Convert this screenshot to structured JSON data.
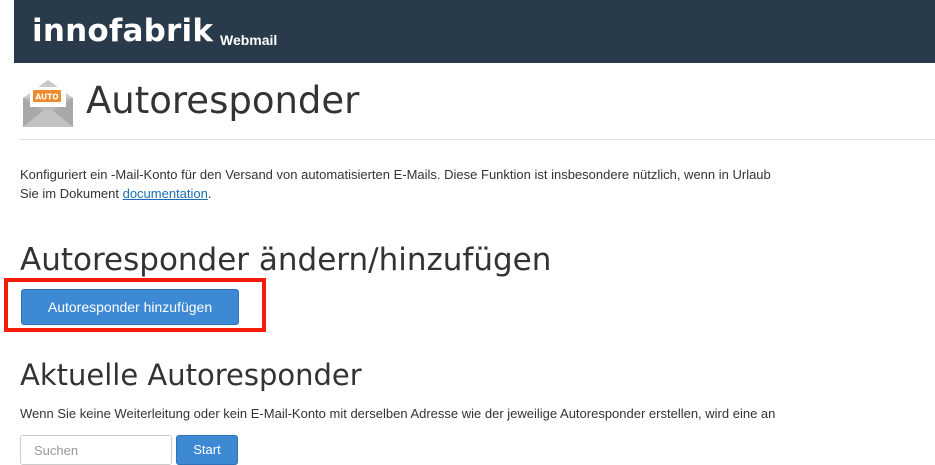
{
  "header": {
    "brand": "innofabrik",
    "subtitle": "Webmail"
  },
  "page": {
    "icon": "autoresponder-envelope-icon",
    "icon_badge": "AUTO",
    "title": "Autoresponder"
  },
  "description": {
    "line1": "Konfiguriert ein -Mail-Konto für den Versand von automatisierten E-Mails. Diese Funktion ist insbesondere nützlich, wenn in Urlaub",
    "line2_prefix": "Sie im Dokument ",
    "link_label": "documentation",
    "line2_suffix": "."
  },
  "section_add": {
    "title": "Autoresponder ändern/hinzufügen",
    "button_label": "Autoresponder hinzufügen"
  },
  "section_current": {
    "title": "Aktuelle Autoresponder",
    "info": "Wenn Sie keine Weiterleitung oder kein E-Mail-Konto mit derselben Adresse wie der jeweilige Autoresponder erstellen, wird eine an",
    "search_placeholder": "Suchen",
    "search_button": "Start"
  },
  "colors": {
    "header_bg": "#293a4a",
    "primary_button": "#3e89d4",
    "highlight_border": "#f31d0a",
    "link": "#1b6db5"
  }
}
